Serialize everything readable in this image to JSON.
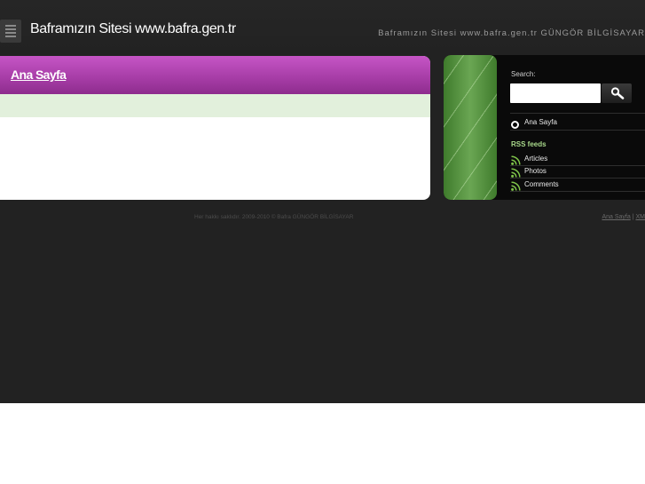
{
  "header": {
    "site_title": "Baframızın Sitesi www.bafra.gen.tr",
    "site_description": "Baframızın Sitesi www.bafra.gen.tr GÜNGÖR BİLGİSAYAR",
    "menu_icon": "menu-icon"
  },
  "main": {
    "page_title": "Ana Sayfa"
  },
  "sidebar": {
    "search": {
      "label": "Search:",
      "value": "",
      "placeholder": "",
      "button_icon": "search-icon"
    },
    "home_link": "Ana Sayfa",
    "rss": {
      "heading": "RSS feeds",
      "items": [
        {
          "label": "Articles",
          "icon": "rss-icon"
        },
        {
          "label": "Photos",
          "icon": "rss-icon"
        },
        {
          "label": "Comments",
          "icon": "rss-icon"
        }
      ]
    }
  },
  "footer": {
    "copyright": "Her hakkı saklıdır. 2009-2010 © Bafra GÜNGÖR BİLGİSAYAR",
    "link_home": "Ana Sayfa",
    "separator": "|",
    "link_xml": "XM"
  },
  "colors": {
    "page_background": "#222222",
    "title_bar": "#a83ea8",
    "band": "#e2f0dc",
    "sidebar_background": "#0a0a0a",
    "rss_heading": "#a9d98b",
    "rss_icon": "#7fc44a"
  }
}
